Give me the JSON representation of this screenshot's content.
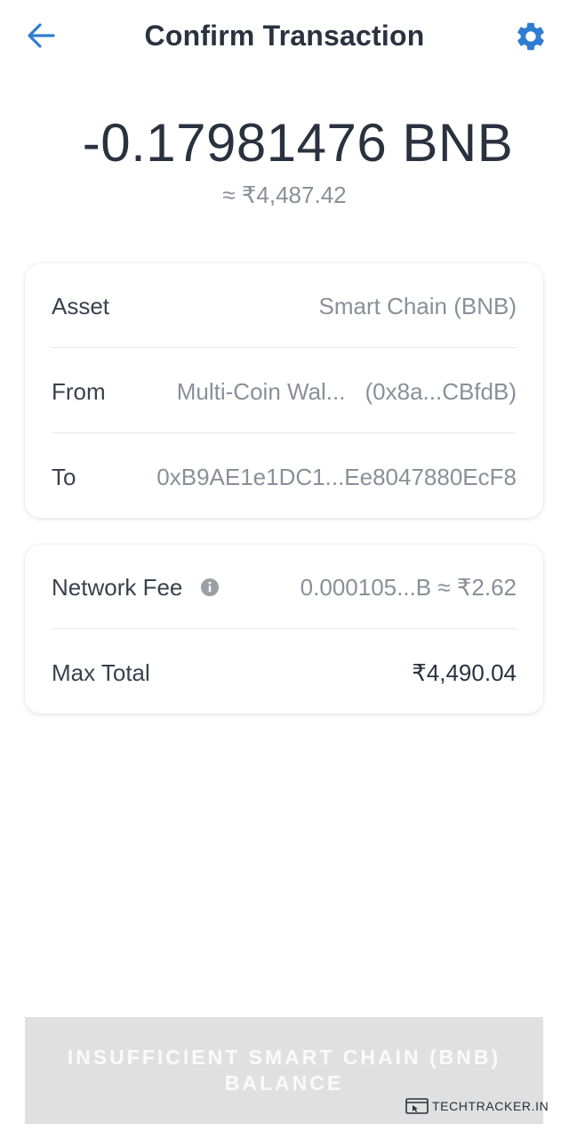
{
  "header": {
    "title": "Confirm Transaction",
    "back_icon": "arrow-left-icon",
    "settings_icon": "gear-icon"
  },
  "transaction": {
    "amount": "-0.17981476 BNB",
    "fiat_estimate": "≈ ₹4,487.42"
  },
  "details": {
    "asset": {
      "label": "Asset",
      "value": "Smart Chain (BNB)"
    },
    "from": {
      "label": "From",
      "wallet_name": "Multi-Coin Wal...",
      "address": "(0x8a...CBfdB)"
    },
    "to": {
      "label": "To",
      "value": "0xB9AE1e1DC1...Ee8047880EcF8"
    }
  },
  "fees": {
    "network_fee": {
      "label": "Network Fee",
      "value": "0.000105...B ≈ ₹2.62",
      "info_icon": "info-icon"
    },
    "max_total": {
      "label": "Max Total",
      "value": "₹4,490.04"
    }
  },
  "action": {
    "line1": "INSUFFICIENT SMART CHAIN (BNB)",
    "line2": "BALANCE"
  },
  "watermark": {
    "text": "TECHTRACKER.IN"
  },
  "colors": {
    "accent": "#2f7dd1",
    "text_primary": "#2a3240",
    "text_secondary": "#8a8f98",
    "button_disabled": "#e0e0e0"
  }
}
